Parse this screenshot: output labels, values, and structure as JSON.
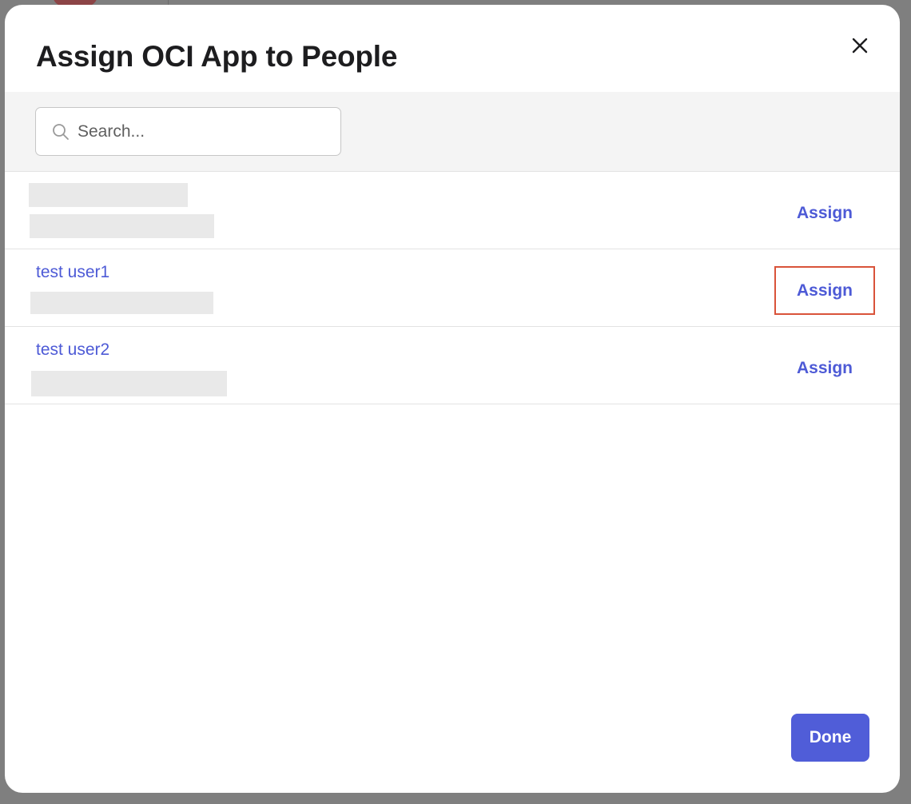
{
  "modal": {
    "title": "Assign OCI App to People",
    "close_icon": "close-icon"
  },
  "search": {
    "placeholder": "Search...",
    "value": "",
    "icon": "search-icon"
  },
  "users": [
    {
      "name": "",
      "assign_label": "Assign",
      "highlighted": false
    },
    {
      "name": "test user1",
      "assign_label": "Assign",
      "highlighted": true
    },
    {
      "name": "test user2",
      "assign_label": "Assign",
      "highlighted": false
    }
  ],
  "footer": {
    "done_label": "Done"
  },
  "colors": {
    "accent": "#505dd8",
    "link": "#4d5ad6",
    "highlight_border": "#d9533a",
    "overlay": "#7f7f7f"
  }
}
